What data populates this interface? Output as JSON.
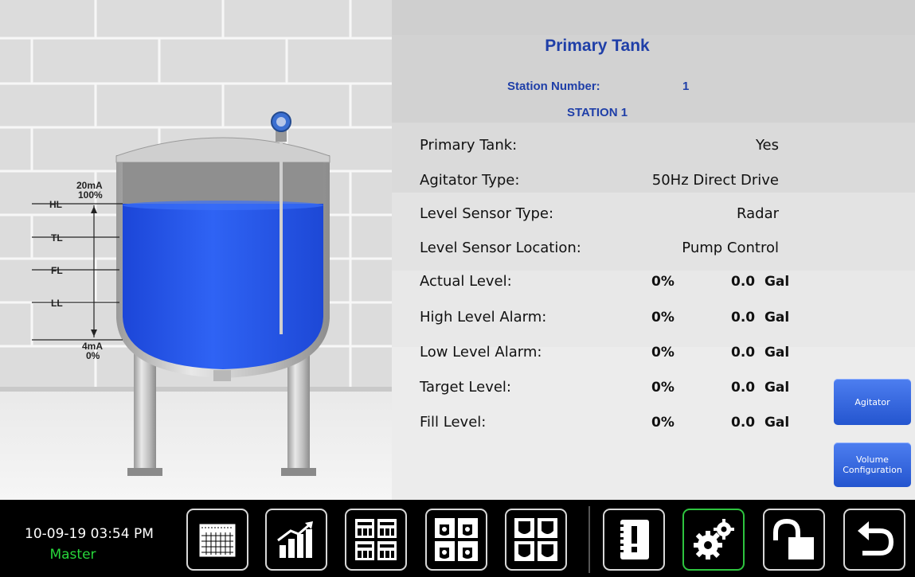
{
  "tank_panel": {
    "title": "Primary Tank",
    "station_number_label": "Station Number:",
    "station_number": "1",
    "station_name": "STATION 1",
    "rows": [
      {
        "label": "Primary Tank:",
        "value": "Yes"
      },
      {
        "label": "Agitator Type:",
        "value": "50Hz Direct Drive"
      },
      {
        "label": "Level Sensor Type:",
        "value": "Radar"
      },
      {
        "label": "Level Sensor Location:",
        "value": "Pump Control"
      },
      {
        "label": "Actual Level:",
        "percent": "0%",
        "gallons": "0.0  Gal"
      },
      {
        "label": "High Level Alarm:",
        "percent": "0%",
        "gallons": "0.0  Gal"
      },
      {
        "label": "Low Level Alarm:",
        "percent": "0%",
        "gallons": "0.0  Gal"
      },
      {
        "label": "Target Level:",
        "percent": "0%",
        "gallons": "0.0  Gal"
      },
      {
        "label": "Fill Level:",
        "percent": "0%",
        "gallons": "0.0  Gal"
      }
    ]
  },
  "side_buttons": {
    "agitator": "Agitator",
    "volume_line1": "Volume",
    "volume_line2": "Configuration"
  },
  "gauge": {
    "top_ma": "20mA",
    "top_pct": "100%",
    "markers": [
      "HL",
      "TL",
      "FL",
      "LL"
    ],
    "bottom_ma": "4mA",
    "bottom_pct": "0%"
  },
  "bottom_bar": {
    "datetime": "10-09-19 03:54 PM",
    "user": "Master",
    "buttons": [
      "calendar-icon",
      "trend-chart-icon",
      "station-grid-icon",
      "tank-info-icon",
      "tank-grid-icon",
      "alarm-book-icon",
      "settings-gears-icon",
      "unlock-icon",
      "back-icon"
    ],
    "active_button": "settings-gears-icon"
  },
  "colors": {
    "title_blue": "#1f3fa8",
    "button_blue": "#2f63dc",
    "liquid_blue": "#2a5cf0",
    "active_green": "#2ec43f",
    "user_green": "#27d63b"
  }
}
